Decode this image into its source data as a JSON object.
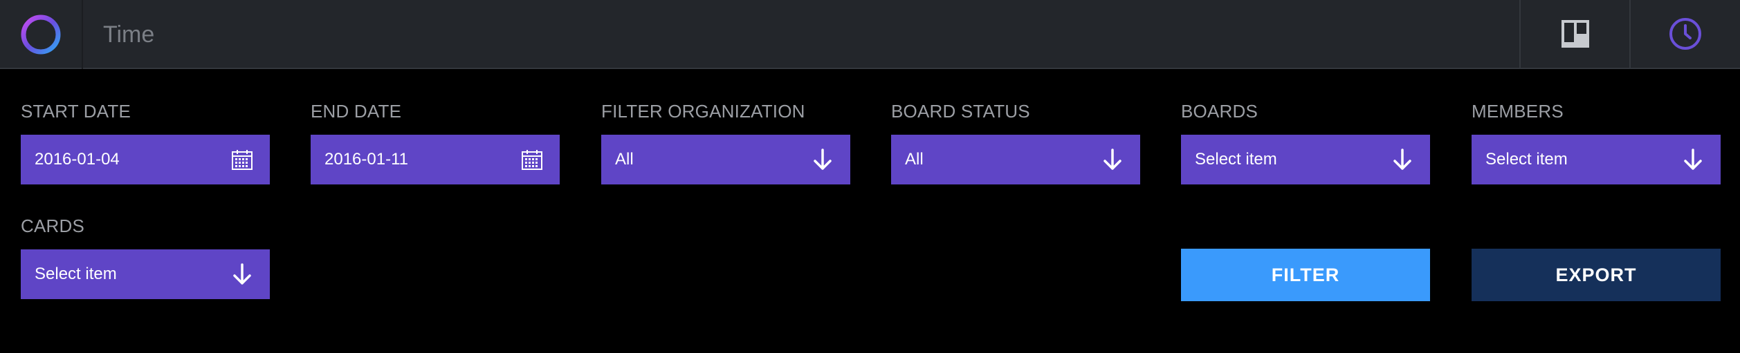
{
  "header": {
    "title": "Time",
    "logo_icon": "ring-logo-icon",
    "buttons": [
      {
        "icon": "board-icon"
      },
      {
        "icon": "clock-icon"
      }
    ]
  },
  "filters": {
    "start_date": {
      "label": "START DATE",
      "value": "2016-01-04",
      "icon": "calendar-icon"
    },
    "end_date": {
      "label": "END DATE",
      "value": "2016-01-11",
      "icon": "calendar-icon"
    },
    "organization": {
      "label": "FILTER ORGANIZATION",
      "value": "All",
      "icon": "arrow-down-icon"
    },
    "board_status": {
      "label": "BOARD STATUS",
      "value": "All",
      "icon": "arrow-down-icon"
    },
    "boards": {
      "label": "BOARDS",
      "value": "Select item",
      "icon": "arrow-down-icon"
    },
    "members": {
      "label": "MEMBERS",
      "value": "Select item",
      "icon": "arrow-down-icon"
    },
    "cards": {
      "label": "CARDS",
      "value": "Select item",
      "icon": "arrow-down-icon"
    }
  },
  "actions": {
    "filter_label": "FILTER",
    "export_label": "EXPORT"
  },
  "colors": {
    "topbar": "#23262b",
    "field": "#5f45c6",
    "filter_button": "#3a9afc",
    "export_button": "#15305a",
    "label": "#9c9fa5",
    "clock_accent": "#6a4fd8"
  }
}
